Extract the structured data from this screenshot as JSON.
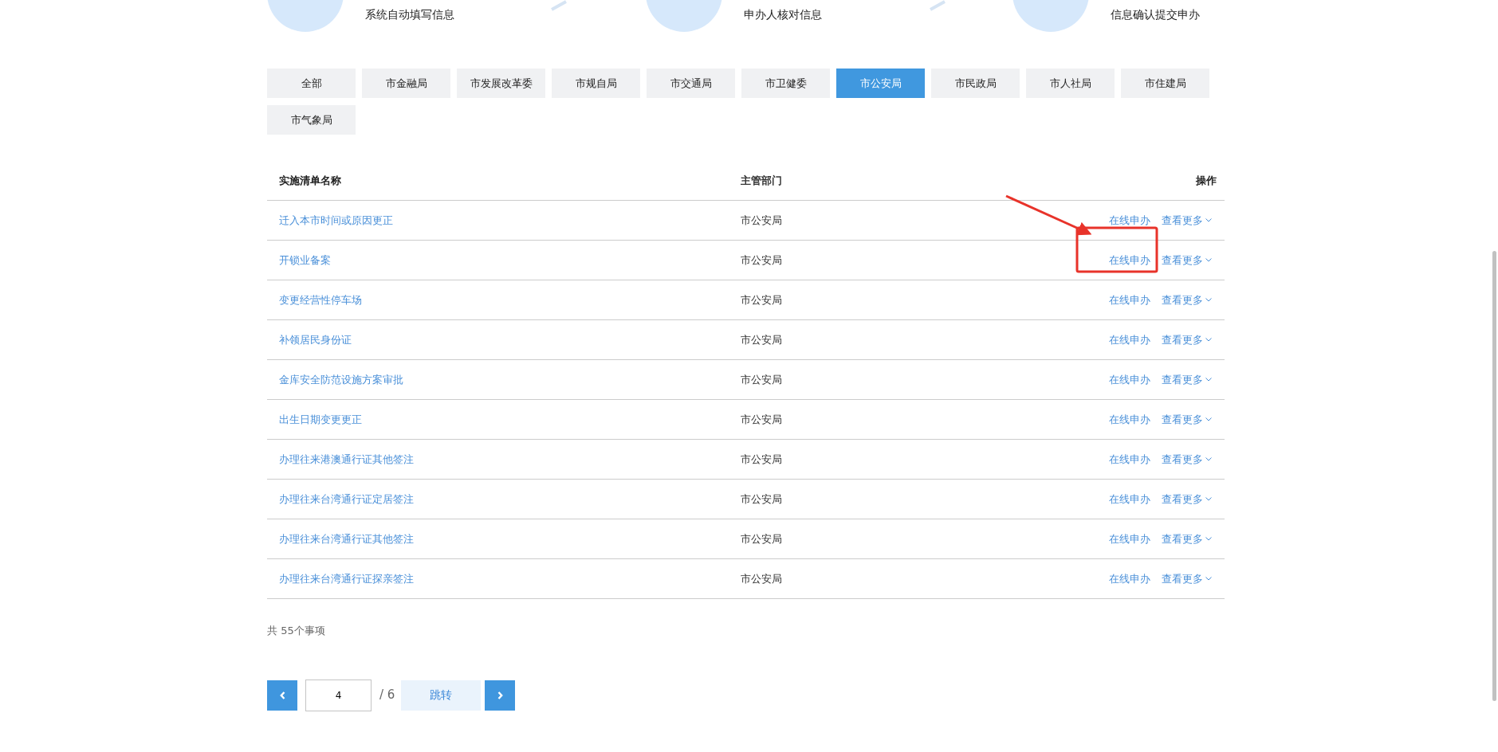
{
  "steps": [
    {
      "label": "系统自动填写信息"
    },
    {
      "label": "申办人核对信息"
    },
    {
      "label": "信息确认提交申办"
    }
  ],
  "tabs": [
    {
      "label": "全部",
      "selected": false
    },
    {
      "label": "市金融局",
      "selected": false
    },
    {
      "label": "市发展改革委",
      "selected": false
    },
    {
      "label": "市规自局",
      "selected": false
    },
    {
      "label": "市交通局",
      "selected": false
    },
    {
      "label": "市卫健委",
      "selected": false
    },
    {
      "label": "市公安局",
      "selected": true
    },
    {
      "label": "市民政局",
      "selected": false
    },
    {
      "label": "市人社局",
      "selected": false
    },
    {
      "label": "市住建局",
      "selected": false
    },
    {
      "label": "市气象局",
      "selected": false
    }
  ],
  "table": {
    "columns": [
      "实施清单名称",
      "主管部门",
      "操作"
    ],
    "rows": [
      {
        "name": "迁入本市时间或原因更正",
        "department": "市公安局",
        "actions": [
          "在线申办",
          "查看更多"
        ]
      },
      {
        "name": "开锁业备案",
        "department": "市公安局",
        "actions": [
          "在线申办",
          "查看更多"
        ]
      },
      {
        "name": "变更经营性停车场",
        "department": "市公安局",
        "actions": [
          "在线申办",
          "查看更多"
        ]
      },
      {
        "name": "补领居民身份证",
        "department": "市公安局",
        "actions": [
          "在线申办",
          "查看更多"
        ]
      },
      {
        "name": "金库安全防范设施方案审批",
        "department": "市公安局",
        "actions": [
          "在线申办",
          "查看更多"
        ]
      },
      {
        "name": "出生日期变更更正",
        "department": "市公安局",
        "actions": [
          "在线申办",
          "查看更多"
        ]
      },
      {
        "name": "办理往来港澳通行证其他签注",
        "department": "市公安局",
        "actions": [
          "在线申办",
          "查看更多"
        ]
      },
      {
        "name": "办理往来台湾通行证定居签注",
        "department": "市公安局",
        "actions": [
          "在线申办",
          "查看更多"
        ]
      },
      {
        "name": "办理往来台湾通行证其他签注",
        "department": "市公安局",
        "actions": [
          "在线申办",
          "查看更多"
        ]
      },
      {
        "name": "办理往来台湾通行证探亲签注",
        "department": "市公安局",
        "actions": [
          "在线申办",
          "查看更多"
        ]
      }
    ]
  },
  "total": "共 55个事项",
  "pagination": {
    "page": "4",
    "of_total": "/ 6",
    "jump": "跳转"
  }
}
